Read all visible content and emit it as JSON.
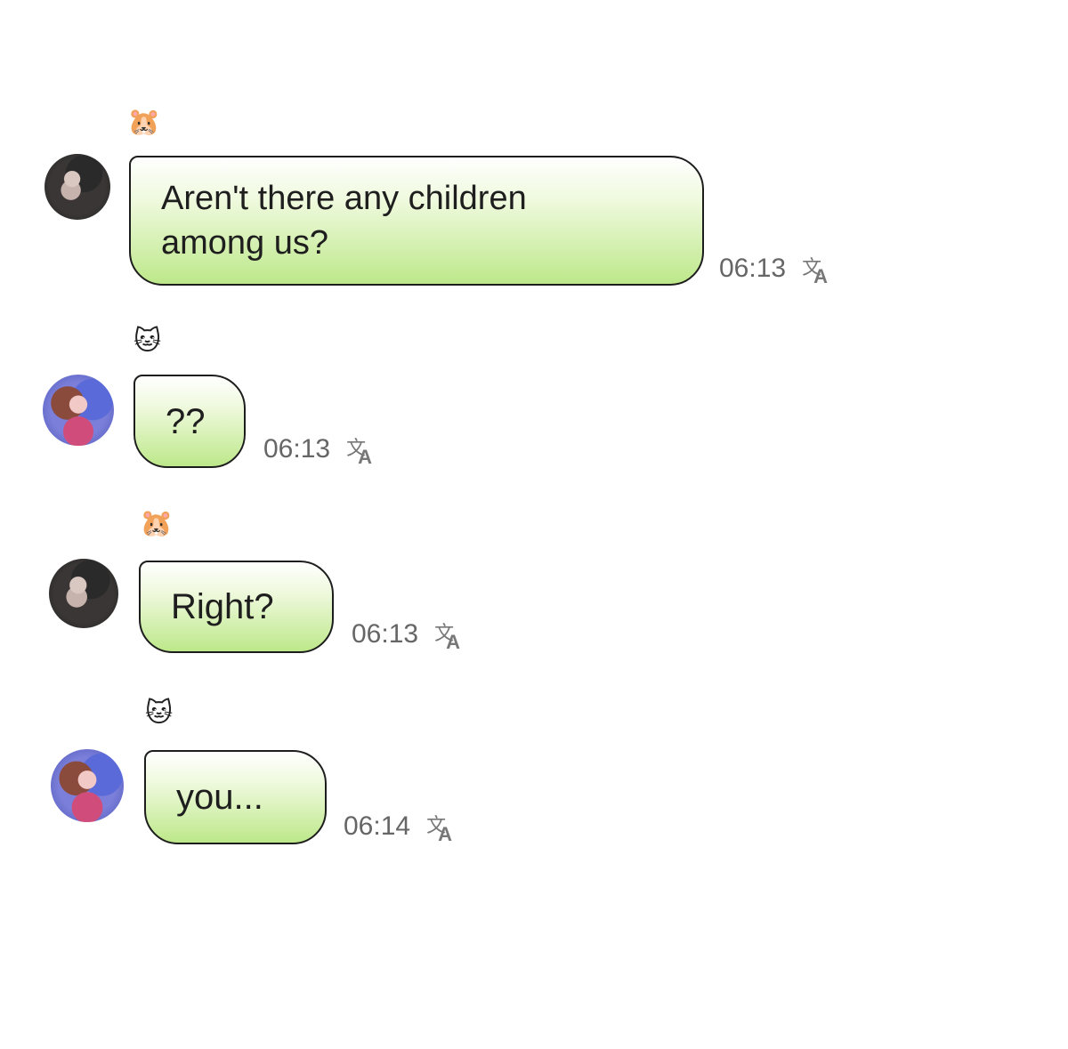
{
  "messages": [
    {
      "sender_emoji": "🐹",
      "avatar_style": "dark",
      "text": "Aren't there any children\namong us?",
      "time": "06:13",
      "translate_glyph_zh": "文",
      "translate_glyph_a": "A"
    },
    {
      "sender_emoji": "🐱",
      "avatar_style": "pink",
      "text": "??",
      "time": "06:13",
      "translate_glyph_zh": "文",
      "translate_glyph_a": "A"
    },
    {
      "sender_emoji": "🐹",
      "avatar_style": "dark",
      "text": "Right?",
      "time": "06:13",
      "translate_glyph_zh": "文",
      "translate_glyph_a": "A"
    },
    {
      "sender_emoji": "🐱",
      "avatar_style": "pink",
      "text": "you...",
      "time": "06:14",
      "translate_glyph_zh": "文",
      "translate_glyph_a": "A"
    }
  ],
  "colors": {
    "bubble_border": "#1d1d1d",
    "bubble_top": "#ffffff",
    "bubble_bottom": "#bde88a",
    "timestamp": "#666666"
  }
}
